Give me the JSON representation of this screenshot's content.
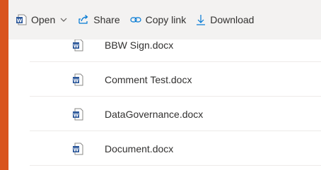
{
  "toolbar": {
    "open_label": "Open",
    "share_label": "Share",
    "copy_link_label": "Copy link",
    "download_label": "Download"
  },
  "icons": {
    "open": "word-doc-icon",
    "open_menu": "chevron-down-icon",
    "share": "share-icon",
    "copy_link": "link-icon",
    "download": "download-icon",
    "file": "word-doc-icon"
  },
  "colors": {
    "frame": "#d9541e",
    "accent": "#0078d4",
    "word_blue": "#2b579a"
  },
  "files": [
    {
      "name": "BBW Sign.docx"
    },
    {
      "name": "Comment Test.docx"
    },
    {
      "name": "DataGovernance.docx"
    },
    {
      "name": "Document.docx"
    }
  ]
}
